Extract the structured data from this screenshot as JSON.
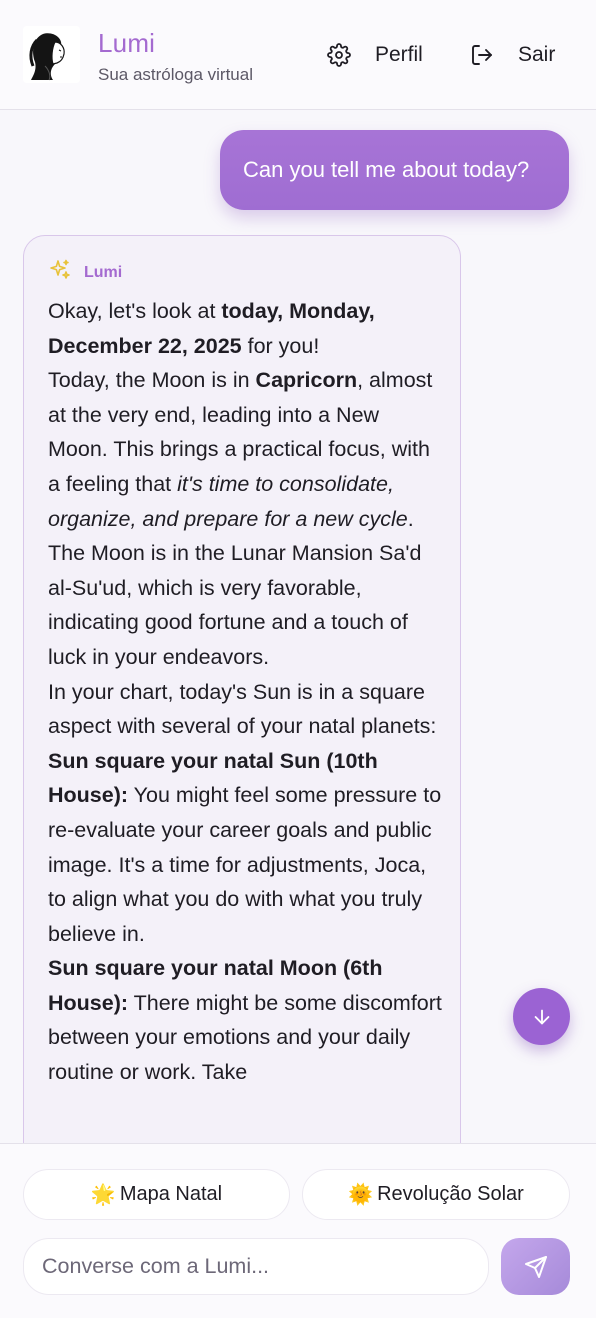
{
  "header": {
    "brand_name": "Lumi",
    "brand_subtitle": "Sua astróloga virtual",
    "profile_label": "Perfil",
    "exit_label": "Sair"
  },
  "chat": {
    "user_message": "Can you tell me about today?",
    "assistant_name": "Lumi",
    "assistant_message": {
      "p1_a": "Okay, let's look at ",
      "p1_b": "today, Monday, December 22, 2025",
      "p1_c": " for you!",
      "p2_a": "Today, the Moon is in ",
      "p2_b": "Capricorn",
      "p2_c": ", almost at the very end, leading into a New Moon. This brings a practical focus, with a feeling that ",
      "p2_d": "it's time to consolidate, organize, and prepare for a new cycle",
      "p2_e": ". The Moon is in the Lunar Mansion Sa'd al-Su'ud, which is very favorable, indicating good fortune and a touch of luck in your endeavors.",
      "p3": "In your chart, today's Sun is in a square aspect with several of your natal planets:",
      "p4_a": "Sun square your natal Sun (10th House):",
      "p4_b": " You might feel some pressure to re-evaluate your career goals and public image. It's a time for adjustments, Joca, to align what you do with what you truly believe in.",
      "p5_a": "Sun square your natal Moon (6th House):",
      "p5_b": " There might be some discomfort between your emotions and your daily routine or work. Take"
    }
  },
  "footer": {
    "chip_natal_emoji": "🌟",
    "chip_natal_label": "Mapa Natal",
    "chip_solar_emoji": "🌞",
    "chip_solar_label": "Revolução Solar",
    "input_placeholder": "Converse com a Lumi..."
  },
  "icons": {
    "settings": "gear-icon",
    "exit": "logout-icon",
    "sparkle": "sparkle-icon",
    "scroll": "arrow-down-icon",
    "send": "send-icon"
  },
  "colors": {
    "accent": "#a46ad0",
    "user_bubble": "#a774d6",
    "scroll_button": "#9b63d3",
    "sparkle": "#e8c23a"
  }
}
